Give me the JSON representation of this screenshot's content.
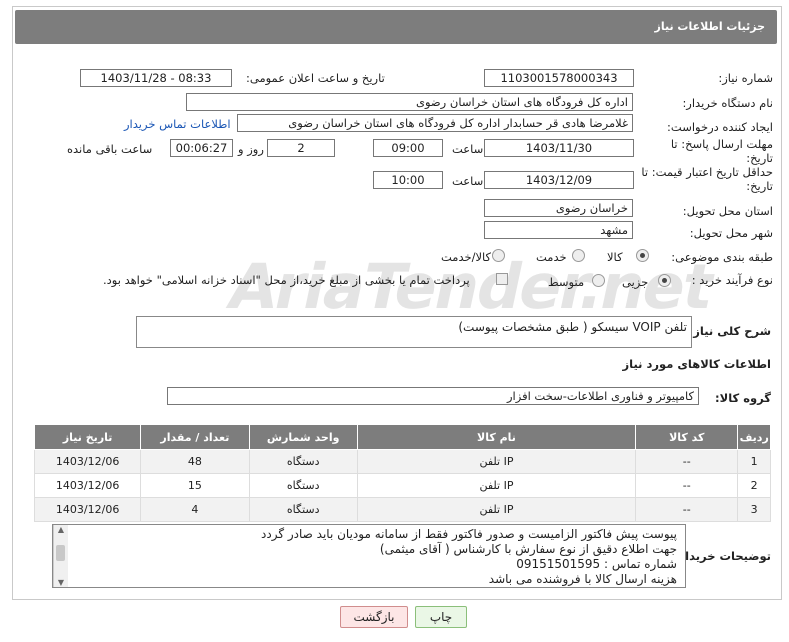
{
  "header": {
    "title": "جزئیات اطلاعات نیاز"
  },
  "fields": {
    "need_number_label": "شماره نیاز:",
    "need_number": "1103001578000343",
    "announce_label": "تاریخ و ساعت اعلان عمومی:",
    "announce_value": "1403/11/28 - 08:33",
    "buyer_org_label": "نام دستگاه خریدار:",
    "buyer_org": "اداره کل فرودگاه های استان خراسان رضوی",
    "requester_label": "ایجاد کننده درخواست:",
    "requester": "غلامرضا هادی قر حسابدار اداره کل فرودگاه های استان خراسان رضوی",
    "contact_link": "اطلاعات تماس خریدار",
    "deadline_label": "مهلت ارسال پاسخ: تا تاریخ:",
    "deadline_date": "1403/11/30",
    "time_label": "ساعت",
    "deadline_time": "09:00",
    "days_value": "2",
    "days_label": "روز و",
    "remaining_time": "00:06:27",
    "remaining_label": "ساعت باقی مانده",
    "validity_label": "حداقل تاریخ اعتبار قیمت: تا تاریخ:",
    "validity_date": "1403/12/09",
    "validity_time_label": "ساعت",
    "validity_time": "10:00",
    "province_label": "استان محل تحویل:",
    "province": "خراسان رضوی",
    "city_label": "شهر محل تحویل:",
    "city": "مشهد",
    "category_label": "طبقه بندی موضوعی:",
    "category_options": [
      "کالا",
      "خدمت",
      "کالا/خدمت"
    ],
    "process_label": "نوع فرآیند خرید :",
    "process_options": [
      "جزیی",
      "متوسط"
    ],
    "payment_note": "پرداخت تمام یا بخشی از مبلغ خرید،از محل \"اسناد خزانه اسلامی\" خواهد بود."
  },
  "description": {
    "label": "شرح کلی نیاز:",
    "value": "تلفن VOIP سیسکو ( طبق مشخصات پیوست)"
  },
  "goods_section": {
    "title": "اطلاعات کالاهای مورد نیاز",
    "group_label": "گروه کالا:",
    "group_value": "کامپیوتر و فناوری اطلاعات-سخت افزار"
  },
  "watermark": "AriaTender.net",
  "table": {
    "headers": [
      "ردیف",
      "کد کالا",
      "نام کالا",
      "واحد شمارش",
      "تعداد / مقدار",
      "تاریخ نیاز"
    ],
    "rows": [
      {
        "row": "1",
        "code": "--",
        "name": "تلفن IP",
        "unit": "دستگاه",
        "qty": "48",
        "date": "1403/12/06"
      },
      {
        "row": "2",
        "code": "--",
        "name": "تلفن IP",
        "unit": "دستگاه",
        "qty": "15",
        "date": "1403/12/06"
      },
      {
        "row": "3",
        "code": "--",
        "name": "تلفن IP",
        "unit": "دستگاه",
        "qty": "4",
        "date": "1403/12/06"
      }
    ]
  },
  "buyer_notes": {
    "label": "توضیحات خریدار:",
    "lines": [
      "پیوست پیش فاکتور الزامیست و صدور فاکتور فقط از سامانه مودیان باید صادر گردد",
      "جهت اطلاع دقیق از نوع سفارش با کارشناس  ( آقای میثمی)",
      "شماره تماس : 09151501595",
      "هزینه ارسال کالا با فروشنده می باشد"
    ]
  },
  "buttons": {
    "print": "چاپ",
    "back": "بازگشت"
  }
}
